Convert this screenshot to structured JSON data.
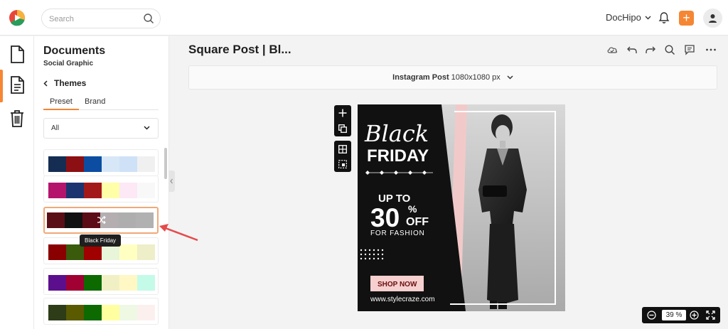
{
  "app": {
    "search_placeholder": "Search",
    "account_name": "DocHipo"
  },
  "rail": {
    "items": [
      "document-icon",
      "template-icon",
      "trash-icon"
    ]
  },
  "panel": {
    "title": "Documents",
    "subtitle": "Social Graphic",
    "section": "Themes",
    "tabs": [
      "Preset",
      "Brand"
    ],
    "filter_value": "All",
    "tooltip": "Black Friday",
    "palettes": [
      [
        "#152d53",
        "#8c0f13",
        "#0c4da2",
        "#d7e7f7",
        "#cfe1f7",
        "#f0f0f0"
      ],
      [
        "#b5146d",
        "#1b3470",
        "#a31919",
        "#ffffa8",
        "#fde8f6",
        "#f8f8f8"
      ],
      [
        "#5a0f16",
        "#111111",
        "#5c0c17",
        "#b5aeb0",
        "#aeaeae",
        "#b1b1b1"
      ],
      [
        "#8a0000",
        "#3a5a0c",
        "#a00000",
        "#e8f5d9",
        "#ffffc2",
        "#eeeec8"
      ],
      [
        "#5c0f8c",
        "#a00032",
        "#0c6a00",
        "#f1f0c4",
        "#fff8c4",
        "#c4fbe8"
      ],
      [
        "#2e3c18",
        "#5a5a00",
        "#0c6a00",
        "#ffffa0",
        "#eef8e3",
        "#fcf0ee"
      ]
    ]
  },
  "main": {
    "title": "Square Post | Bl...",
    "size_label": "Instagram Post",
    "size_value": "1080x1080 px",
    "zoom": "39 %"
  },
  "design": {
    "headline_script": "Black",
    "headline": "FRIDAY",
    "offer_prefix": "UP TO",
    "offer_number": "30",
    "offer_percent": "%",
    "offer_suffix": "OFF",
    "offer_sub": "FOR FASHION",
    "cta": "SHOP NOW",
    "url": "www.stylecraze.com"
  },
  "colors": {
    "accent": "#f58634",
    "cta_bg": "#f6cfcf",
    "cta_text": "#6a0d0d"
  }
}
